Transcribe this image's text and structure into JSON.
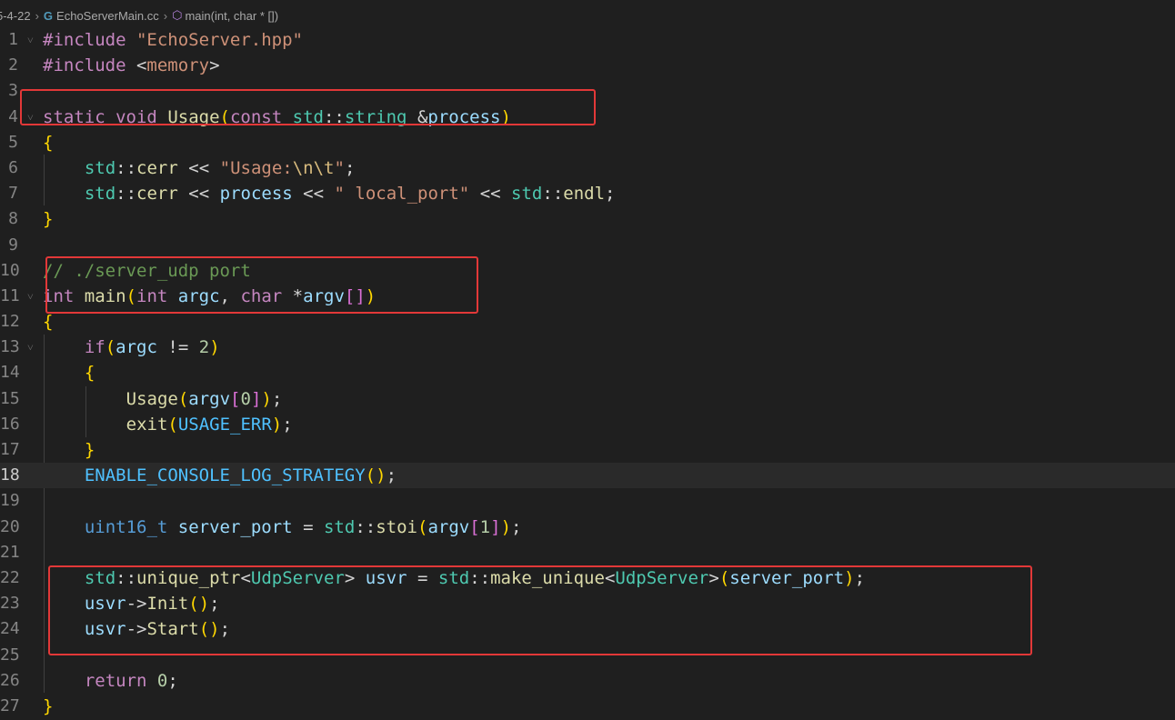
{
  "breadcrumb": {
    "folder": "5-4-22",
    "file": "EchoServerMain.cc",
    "symbol": "main(int, char * [])"
  },
  "editor": {
    "current_line": 18,
    "lines": [
      {
        "n": "1",
        "text": "#include \"EchoServer.hpp\""
      },
      {
        "n": "2",
        "text": "#include <memory>"
      },
      {
        "n": "3",
        "text": ""
      },
      {
        "n": "4",
        "text": "static void Usage(const std::string &process)"
      },
      {
        "n": "5",
        "text": "{"
      },
      {
        "n": "6",
        "text": "    std::cerr << \"Usage:\\n\\t\";"
      },
      {
        "n": "7",
        "text": "    std::cerr << process << \" local_port\" << std::endl;"
      },
      {
        "n": "8",
        "text": "}"
      },
      {
        "n": "9",
        "text": ""
      },
      {
        "n": "10",
        "text": "// ./server_udp port"
      },
      {
        "n": "11",
        "text": "int main(int argc, char *argv[])"
      },
      {
        "n": "12",
        "text": "{"
      },
      {
        "n": "13",
        "text": "    if(argc != 2)"
      },
      {
        "n": "14",
        "text": "    {"
      },
      {
        "n": "15",
        "text": "        Usage(argv[0]);"
      },
      {
        "n": "16",
        "text": "        exit(USAGE_ERR);"
      },
      {
        "n": "17",
        "text": "    }"
      },
      {
        "n": "18",
        "text": "    ENABLE_CONSOLE_LOG_STRATEGY();"
      },
      {
        "n": "19",
        "text": ""
      },
      {
        "n": "20",
        "text": "    uint16_t server_port = std::stoi(argv[1]);"
      },
      {
        "n": "21",
        "text": ""
      },
      {
        "n": "22",
        "text": "    std::unique_ptr<UdpServer> usvr = std::make_unique<UdpServer>(server_port);"
      },
      {
        "n": "23",
        "text": "    usvr->Init();"
      },
      {
        "n": "24",
        "text": "    usvr->Start();"
      },
      {
        "n": "25",
        "text": ""
      },
      {
        "n": "26",
        "text": "    return 0;"
      },
      {
        "n": "27",
        "text": "}"
      }
    ]
  },
  "colors": {
    "background": "#1f1f1f",
    "highlight_box": "#e23838",
    "current_line": "#2a2a2a"
  }
}
